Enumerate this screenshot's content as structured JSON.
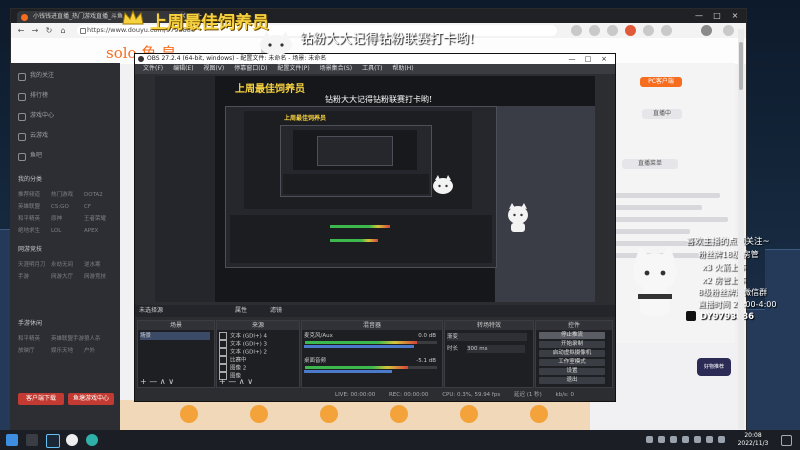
{
  "overlay": {
    "best_title": "上周最佳饲养员",
    "marquee": "钻粉大大记得钻粉联赛打卡哟!",
    "site_logo": "solo 鱼 皇"
  },
  "browser": {
    "tab_title": "小钱钱进直播_热门游戏直播_斗鱼",
    "url": "https://www.douyu.com/9793886",
    "window_controls": [
      "—",
      "□",
      "×"
    ],
    "tab_close": "×",
    "new_tab": "+"
  },
  "nav": {
    "items": [
      "我的关注",
      "排行榜",
      "游戏中心",
      "云游戏",
      "鱼吧"
    ],
    "section_label": "我的分类",
    "grid": [
      [
        "推荐频道",
        "热门游戏",
        "DOTA2"
      ],
      [
        "英雄联盟",
        "CS:GO",
        "CF"
      ],
      [
        "和平精英",
        "原神",
        "王者荣耀"
      ],
      [
        "绝地求生",
        "LOL",
        "APEX"
      ]
    ],
    "section2_label": "网游竞技",
    "grid2": [
      [
        "天涯明月刀",
        "永劫无间",
        "逆水寒"
      ],
      [
        "手游",
        "网游大厅",
        "网游竞技"
      ]
    ],
    "section3_label": "手游休闲",
    "grid3": [
      [
        "和平精英",
        "英雄联盟手游",
        "狼人杀"
      ],
      [
        "放映厅",
        "娱乐天地",
        "户外"
      ]
    ],
    "bottom_buttons": [
      "客户端下载",
      "鱼塘游戏中心"
    ]
  },
  "obs": {
    "title": "OBS 27.2.4 (64-bit, windows) - 配置文件: 未命名 - 场景: 未命名",
    "menu": [
      "文件(F)",
      "编辑(E)",
      "视图(V)",
      "停靠窗口(D)",
      "配置文件(P)",
      "场景集合(S)",
      "工具(T)",
      "帮助(H)"
    ],
    "no_source": "未选择源",
    "props_label": "属性",
    "filters_label": "滤镜",
    "dock_headers": [
      "场景",
      "来源",
      "混音器",
      "转场特效",
      "控件"
    ],
    "scene": "场景",
    "sources": [
      "文本 (GDI+) 4",
      "文本 (GDI+) 3",
      "文本 (GDI+) 2",
      "比赛中",
      "图像 2",
      "图像"
    ],
    "mixer": [
      {
        "name": "麦克风/Aux",
        "db": "0.0 dB"
      },
      {
        "name": "桌面音频",
        "db": "-5.1 dB"
      }
    ],
    "transition": {
      "type": "渐变",
      "duration_label": "时长",
      "duration": "300 ms"
    },
    "controls": [
      "停止推流",
      "开始录制",
      "启动虚拟摄像机",
      "工作室模式",
      "设置",
      "退出"
    ],
    "dock_footer": "+ — ∧ ∨",
    "status": [
      "LIVE: 00:00:00",
      "REC: 00:00:00",
      "CPU: 0.3%, 59.94 fps",
      "延迟 (1 秒)",
      "kb/s: 0"
    ]
  },
  "fan_panel": {
    "title": "喜欢主播的点点关注~",
    "lines": [
      "粉丝牌18级 房管",
      "x3 火箭上车",
      "x2 房管上车",
      "8级粉丝牌进微信群",
      "直播时间 20:00-4:00"
    ],
    "douyin_id": "DY9793886"
  },
  "page_right": {
    "buttons": [
      "PC客户端",
      "直播中",
      "直播菜单"
    ]
  },
  "sticker": "好物推荐",
  "taskbar": {
    "time": "20:08",
    "date": "2022/11/3",
    "icons": [
      "windows-icon",
      "search-icon",
      "steam-icon",
      "obs-icon",
      "edge-icon"
    ]
  }
}
